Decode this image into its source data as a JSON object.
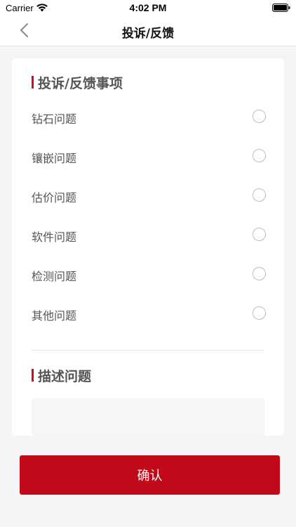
{
  "status_bar": {
    "carrier": "Carrier",
    "time": "4:02 PM"
  },
  "nav": {
    "title": "投诉/反馈"
  },
  "section_issue": {
    "title": "投诉/反馈事项"
  },
  "options": [
    {
      "label": "钻石问题"
    },
    {
      "label": "镶嵌问题"
    },
    {
      "label": "估价问题"
    },
    {
      "label": "软件问题"
    },
    {
      "label": "检测问题"
    },
    {
      "label": "其他问题"
    }
  ],
  "section_desc": {
    "title": "描述问题"
  },
  "confirm": {
    "label": "确认"
  },
  "colors": {
    "accent": "#c00a1a",
    "background": "#f4f5f7"
  }
}
